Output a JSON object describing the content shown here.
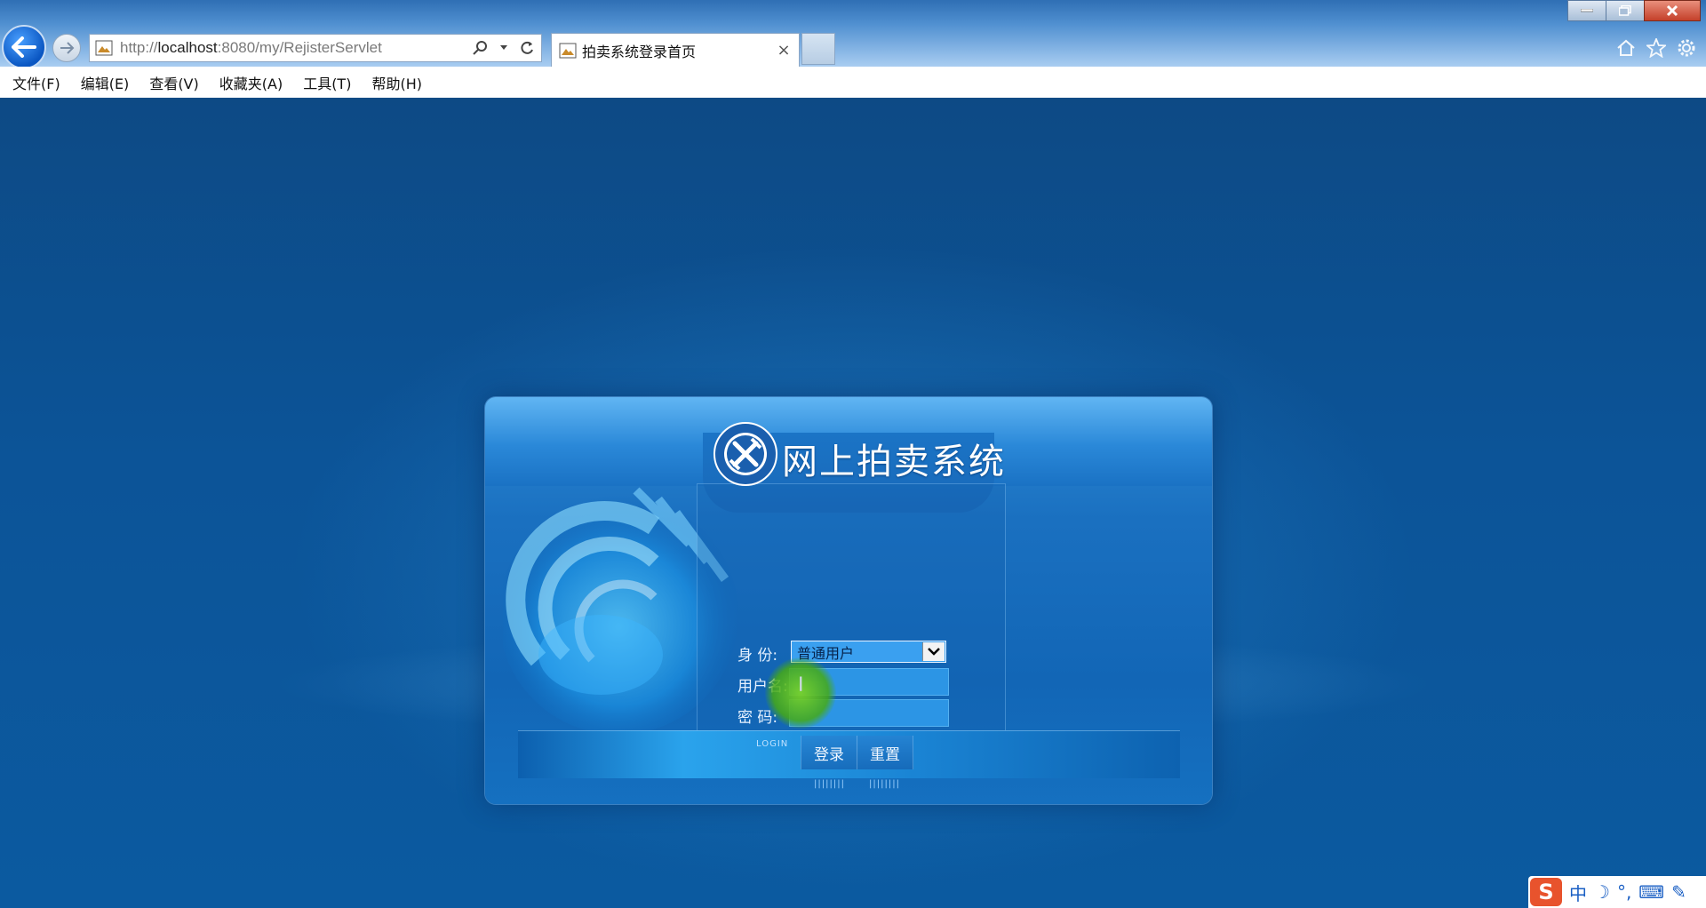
{
  "browser": {
    "address": {
      "prefix": "http://",
      "host": "localhost",
      "suffix": ":8080/my/RejisterServlet"
    },
    "tab": {
      "title": "拍卖系统登录首页",
      "close": "×"
    },
    "menu": [
      "文件(F)",
      "编辑(E)",
      "查看(V)",
      "收藏夹(A)",
      "工具(T)",
      "帮助(H)"
    ]
  },
  "login": {
    "title": "网上拍卖系统",
    "identity_label": "身  份:",
    "identity_value": "普通用户",
    "username_label": "用户名:",
    "password_label": "密  码:",
    "login_caption": "LOGIN",
    "login_button": "登录",
    "reset_button": "重置",
    "btn_ticks": "||||||||"
  },
  "ime": {
    "logo": "S",
    "mode": "中",
    "moon": "☽",
    "punct": "°,",
    "keyboard": "⌨",
    "tool": "✎"
  },
  "colors": {
    "page_bg": "#0b5aa0",
    "panel": "#1a70c0",
    "accent": "#3aa0f0"
  }
}
